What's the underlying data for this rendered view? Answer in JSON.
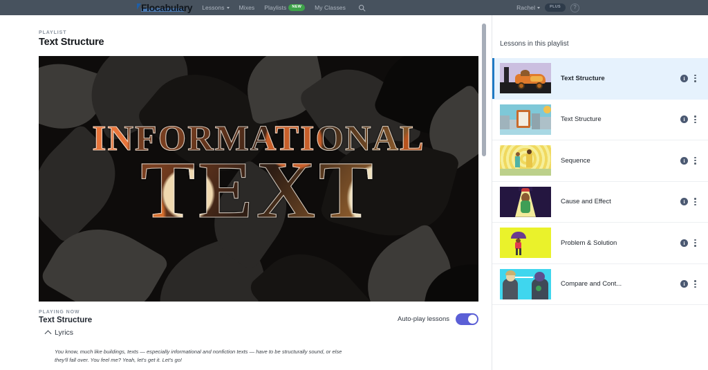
{
  "header": {
    "logo_text": "Flocabulary",
    "nav": [
      {
        "label": "Lessons",
        "has_caret": true,
        "badge": ""
      },
      {
        "label": "Mixes",
        "has_caret": false,
        "badge": ""
      },
      {
        "label": "Playlists",
        "has_caret": false,
        "badge": "NEW"
      },
      {
        "label": "My Classes",
        "has_caret": false,
        "badge": ""
      }
    ],
    "search_icon": "search-icon",
    "user_name": "Rachel",
    "user_badge": "PLUS",
    "help_icon": "?",
    "background_color": "#47525e"
  },
  "playlist": {
    "eyebrow": "PLAYLIST",
    "title": "Text Structure"
  },
  "video": {
    "title_line1": "INFORMATIONAL",
    "title_line2": "TEXT"
  },
  "playing_now": {
    "eyebrow": "PLAYING NOW",
    "title": "Text Structure",
    "lyrics_toggle_label": "Lyrics",
    "lyrics_text": "You know, much like buildings, texts — especially informational and nonfiction texts — have to be structurally sound, or else they'll fall over. You feel me? Yeah, let's get it. Let's go!"
  },
  "autoplay": {
    "label": "Auto-play lessons",
    "enabled": true,
    "accent_color": "#5b5fd6"
  },
  "sidebar": {
    "heading": "Lessons in this playlist",
    "active_accent_color": "#1f7ac4",
    "active_background_color": "#e6f2fd",
    "items": [
      {
        "label": "Text Structure",
        "active": true,
        "info_icon": "info-icon",
        "menu_icon": "kebab-menu-icon"
      },
      {
        "label": "Text Structure",
        "active": false,
        "info_icon": "info-icon",
        "menu_icon": "kebab-menu-icon"
      },
      {
        "label": "Sequence",
        "active": false,
        "info_icon": "info-icon",
        "menu_icon": "kebab-menu-icon"
      },
      {
        "label": "Cause and Effect",
        "active": false,
        "info_icon": "info-icon",
        "menu_icon": "kebab-menu-icon"
      },
      {
        "label": "Problem & Solution",
        "active": false,
        "info_icon": "info-icon",
        "menu_icon": "kebab-menu-icon"
      },
      {
        "label": "Compare and Cont...",
        "active": false,
        "info_icon": "info-icon",
        "menu_icon": "kebab-menu-icon"
      }
    ]
  }
}
